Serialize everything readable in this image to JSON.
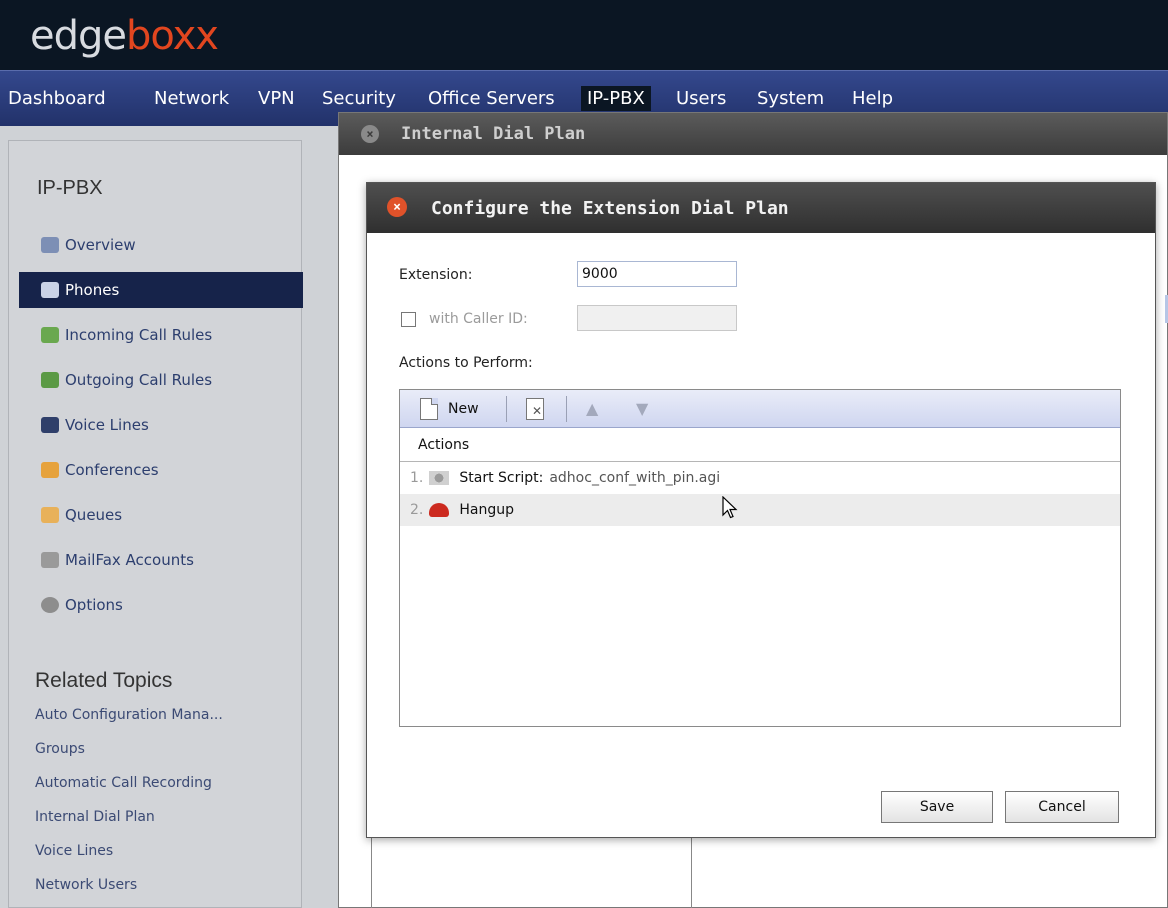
{
  "brand": {
    "part1": "edge",
    "part2": "boxx"
  },
  "nav": {
    "items": [
      "Dashboard",
      "Network",
      "VPN",
      "Security",
      "Office Servers",
      "IP-PBX",
      "Users",
      "System",
      "Help"
    ],
    "active": "IP-PBX"
  },
  "sidebar": {
    "title": "IP-PBX",
    "items": [
      {
        "label": "Overview",
        "icon": "overview-icon"
      },
      {
        "label": "Phones",
        "icon": "phone-icon"
      },
      {
        "label": "Incoming Call Rules",
        "icon": "incoming-call-icon"
      },
      {
        "label": "Outgoing Call Rules",
        "icon": "outgoing-call-icon"
      },
      {
        "label": "Voice Lines",
        "icon": "voice-lines-icon"
      },
      {
        "label": "Conferences",
        "icon": "conference-icon"
      },
      {
        "label": "Queues",
        "icon": "queues-icon"
      },
      {
        "label": "MailFax Accounts",
        "icon": "fax-icon"
      },
      {
        "label": "Options",
        "icon": "gears-icon"
      }
    ],
    "active": "Phones",
    "related_title": "Related Topics",
    "related": [
      "Auto Configuration Mana...",
      "Groups",
      "Automatic Call Recording",
      "Internal Dial Plan",
      "Voice Lines",
      "Network Users"
    ]
  },
  "bg_dialog": {
    "title": "Internal Dial Plan"
  },
  "dialog": {
    "title": "Configure the Extension Dial Plan",
    "extension_label": "Extension:",
    "extension_value": "9000",
    "caller_id_label": "with Caller ID:",
    "caller_id_value": "",
    "caller_id_checked": false,
    "actions_label": "Actions to Perform:",
    "toolbar": {
      "new_label": "New"
    },
    "grid": {
      "column": "Actions",
      "rows": [
        {
          "num": "1.",
          "icon": "script-gears-icon",
          "name": "Start Script:",
          "arg": "adhoc_conf_with_pin.agi"
        },
        {
          "num": "2.",
          "icon": "hangup-icon",
          "name": "Hangup",
          "arg": ""
        }
      ]
    },
    "save_label": "Save",
    "cancel_label": "Cancel"
  },
  "colors": {
    "header_bg": "#0b1623",
    "nav_bg": "#2c3f82",
    "accent_orange": "#e2461f",
    "sidebar_active": "#16234a",
    "toolbar_bg": "#d9def3"
  }
}
